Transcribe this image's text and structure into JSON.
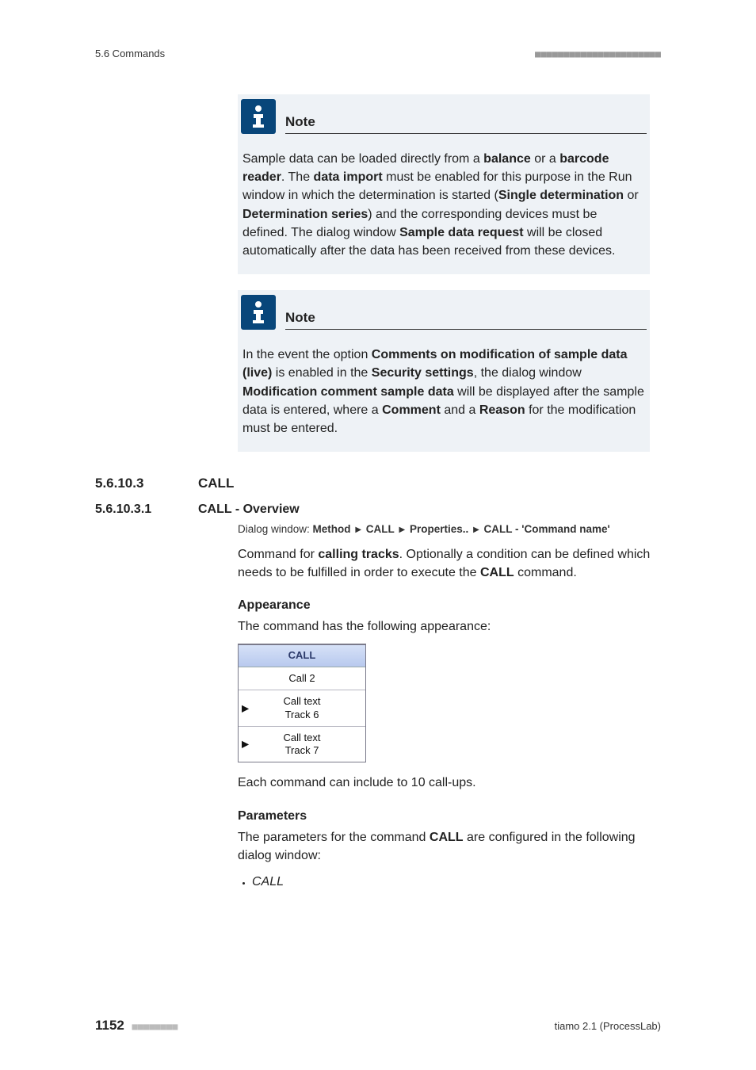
{
  "header": {
    "left": "5.6 Commands",
    "ticks": "■■■■■■■■■■■■■■■■■■■■■■"
  },
  "notes": [
    {
      "title": "Note",
      "body_html": "Sample data can be loaded directly from a <b>balance</b> or a <b>barcode reader</b>. The <b>data import</b> must be enabled for this purpose in the Run window in which the determination is started (<b>Single determination</b> or <b>Determination series</b>) and the corresponding devices must be defined. The dialog window <b>Sample data request</b> will be closed automatically after the data has been received from these devices."
    },
    {
      "title": "Note",
      "body_html": "In the event the option <b>Comments on modification of sample data (live)</b> is enabled in the <b>Security settings</b>, the dialog window <b>Modification comment sample data</b> will be displayed after the sample data is entered, where a <b>Comment</b> and a <b>Reason</b> for the modification must be entered."
    }
  ],
  "section": {
    "num": "5.6.10.3",
    "title": "CALL"
  },
  "subsection": {
    "num": "5.6.10.3.1",
    "title": "CALL - Overview"
  },
  "dialog_path": {
    "prefix": "Dialog window: ",
    "parts": [
      "Method",
      "CALL",
      "Properties..",
      "CALL - 'Command name'"
    ]
  },
  "intro_html": "Command for <b>calling tracks</b>. Optionally a condition can be defined which needs to be fulfilled in order to execute the <b>CALL</b> command.",
  "appearance": {
    "head": "Appearance",
    "lead": "The command has the following appearance:"
  },
  "call_block": {
    "title": "CALL",
    "rows": [
      {
        "lines": [
          "Call 2"
        ],
        "arrow": false
      },
      {
        "lines": [
          "Call text",
          "Track 6"
        ],
        "arrow": true
      },
      {
        "lines": [
          "Call text",
          "Track 7"
        ],
        "arrow": true
      }
    ]
  },
  "after_block": "Each command can include to 10 call-ups.",
  "parameters": {
    "head": "Parameters",
    "lead_html": "The parameters for the command <b>CALL</b> are configured in the following dialog window:",
    "items": [
      "CALL"
    ]
  },
  "footer": {
    "page": "1152",
    "ticks": "■■■■■■■■",
    "right": "tiamo 2.1 (ProcessLab)"
  }
}
